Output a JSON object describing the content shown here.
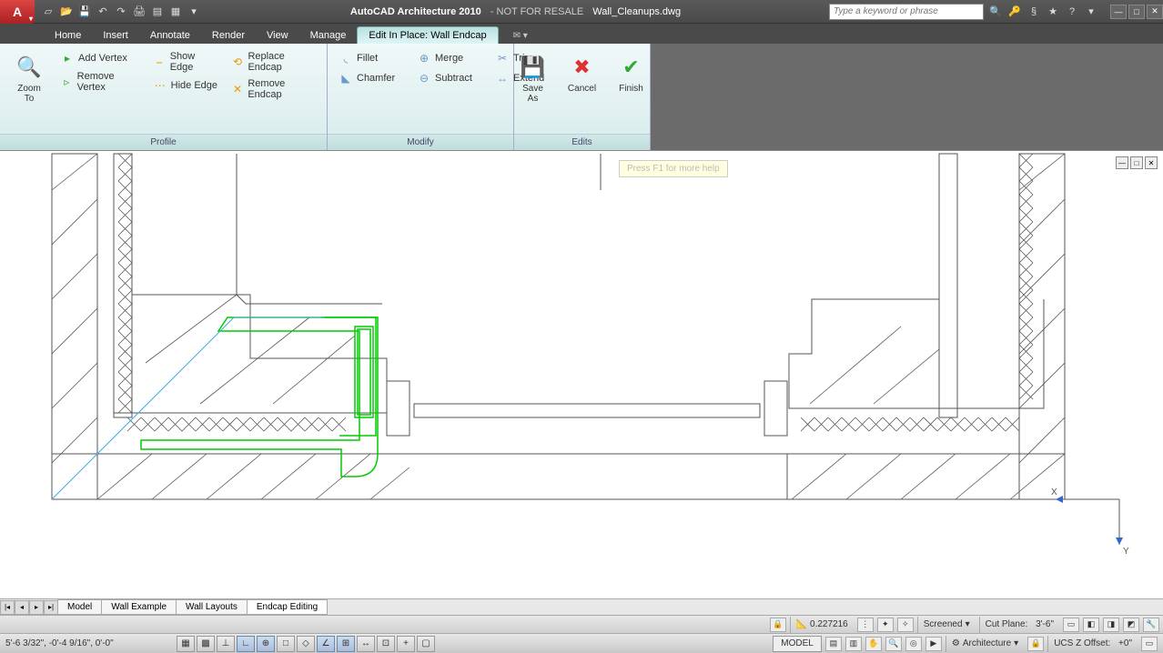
{
  "title": {
    "app": "AutoCAD Architecture 2010",
    "sub": "- NOT FOR RESALE",
    "file": "Wall_Cleanups.dwg"
  },
  "search": {
    "placeholder": "Type a keyword or phrase"
  },
  "tabs": {
    "home": "Home",
    "insert": "Insert",
    "annotate": "Annotate",
    "render": "Render",
    "view": "View",
    "manage": "Manage",
    "active": "Edit In Place: Wall Endcap"
  },
  "ribbon": {
    "zoom_to": "Zoom To",
    "add_vertex": "Add Vertex",
    "remove_vertex": "Remove Vertex",
    "show_edge": "Show Edge",
    "hide_edge": "Hide Edge",
    "replace_endcap": "Replace Endcap",
    "remove_endcap": "Remove Endcap",
    "fillet": "Fillet",
    "chamfer": "Chamfer",
    "merge": "Merge",
    "subtract": "Subtract",
    "trim": "Trim",
    "extend": "Extend",
    "save_as": "Save As",
    "cancel": "Cancel",
    "finish": "Finish",
    "panel_profile": "Profile",
    "panel_modify": "Modify",
    "panel_edits": "Edits"
  },
  "tooltip": "Press F1 for more help",
  "layout_tabs": {
    "model": "Model",
    "t1": "Wall Example",
    "t2": "Wall Layouts",
    "t3": "Endcap Editing"
  },
  "status1": {
    "scale_val": "0.227216",
    "visual_style": "Screened",
    "cut_plane_label": "Cut Plane:",
    "cut_plane_val": "3'-6\""
  },
  "status2": {
    "coords": "5'-6 3/32\",  -0'-4 9/16\",  0'-0\"",
    "model": "MODEL",
    "arch_label": "Architecture",
    "ucs_label": "UCS Z Offset:",
    "ucs_val": "+0\""
  }
}
